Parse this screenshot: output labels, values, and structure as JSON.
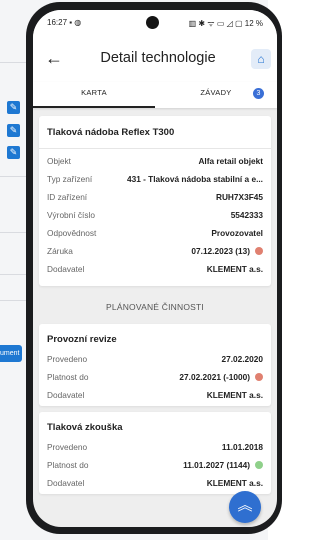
{
  "background_app": {
    "button_label": "ument"
  },
  "status": {
    "time": "16:27 ▪ ◍",
    "right": "▥ ✱ ᯤ ▭ ◿ ▢ 12 %"
  },
  "header": {
    "title": "Detail technologie",
    "back_icon": "arrow-left-icon",
    "home_icon": "home-icon"
  },
  "tabs": [
    {
      "label": "KARTA"
    },
    {
      "label": "ZÁVADY",
      "badge": "3"
    }
  ],
  "detail": {
    "title": "Tlaková nádoba Reflex T300",
    "rows": [
      {
        "label": "Objekt",
        "value": "Alfa retail objekt"
      },
      {
        "label": "Typ zařízení",
        "value": "431 - Tlaková nádoba stabilní a e..."
      },
      {
        "label": "ID zařízení",
        "value": "RUH7X3F45"
      },
      {
        "label": "Výrobní číslo",
        "value": "5542333"
      },
      {
        "label": "Odpovědnost",
        "value": "Provozovatel"
      },
      {
        "label": "Záruka",
        "value": "07.12.2023 (13)",
        "status_color": "#e08070"
      },
      {
        "label": "Dodavatel",
        "value": "KLEMENT a.s."
      }
    ]
  },
  "planned_section": {
    "title": "PLÁNOVANÉ ČINNOSTI"
  },
  "activities": [
    {
      "title": "Provozní revize",
      "rows": [
        {
          "label": "Provedeno",
          "value": "27.02.2020"
        },
        {
          "label": "Platnost do",
          "value": "27.02.2021 (-1000)",
          "status_color": "#e08070"
        },
        {
          "label": "Dodavatel",
          "value": "KLEMENT a.s."
        }
      ]
    },
    {
      "title": "Tlaková zkouška",
      "rows": [
        {
          "label": "Provedeno",
          "value": "11.01.2018"
        },
        {
          "label": "Platnost do",
          "value": "11.01.2027 (1144)",
          "status_color": "#8fd08a"
        },
        {
          "label": "Dodavatel",
          "value": "KLEMENT a.s."
        }
      ]
    }
  ],
  "fab": {
    "icon": "double-chevron-up-icon"
  },
  "colors": {
    "accent": "#2f6fd0",
    "badge": "#3a6fd6"
  }
}
